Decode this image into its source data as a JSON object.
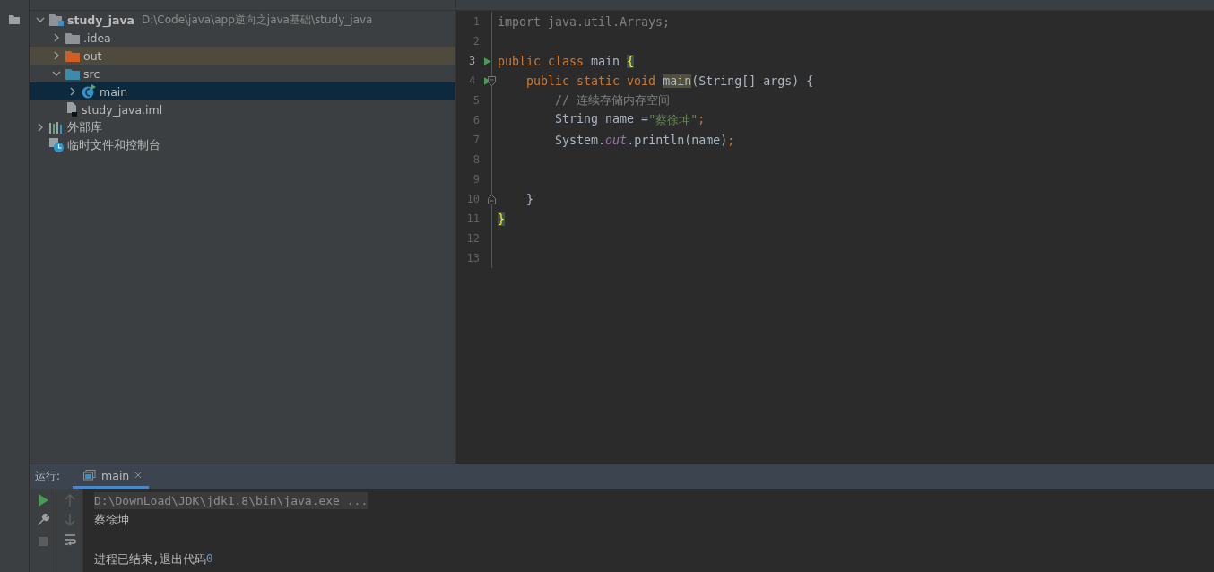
{
  "project_tree": {
    "items": [
      {
        "label": "study_java",
        "path": "D:\\Code\\java\\app逆向之java基础\\study_java",
        "kind": "module",
        "expanded": true,
        "selected": false,
        "children": [
          {
            "label": ".idea",
            "kind": "folder",
            "expanded": false,
            "selected": false
          },
          {
            "label": "out",
            "kind": "excluded-folder",
            "expanded": false,
            "selected": false
          },
          {
            "label": "src",
            "kind": "source-folder",
            "expanded": true,
            "selected": false,
            "children": [
              {
                "label": "main",
                "kind": "class",
                "expanded": false,
                "selected": true
              }
            ]
          },
          {
            "label": "study_java.iml",
            "kind": "file",
            "selected": false
          }
        ]
      },
      {
        "label": "外部库",
        "kind": "library",
        "expanded": false,
        "selected": false
      },
      {
        "label": "临时文件和控制台",
        "kind": "scratch",
        "selected": false
      }
    ]
  },
  "editor": {
    "lines": [
      {
        "number": "1",
        "current": false,
        "tokens": [
          {
            "kind": "unused",
            "text": "import java.util.Arrays;"
          }
        ]
      },
      {
        "number": "2",
        "current": false
      },
      {
        "number": "3",
        "current": true,
        "run": true,
        "tokens": [
          {
            "kind": "keyword",
            "text": "public class "
          },
          {
            "kind": "plain",
            "text": "main "
          },
          {
            "kind": "brace-match",
            "text": "{"
          }
        ]
      },
      {
        "number": "4",
        "current": false,
        "run": true,
        "fold_start": true,
        "tokens": [
          {
            "kind": "keyword",
            "text": "    public static void "
          },
          {
            "kind": "usage",
            "text": "main"
          },
          {
            "kind": "plain",
            "text": "(String[] args) {"
          }
        ]
      },
      {
        "number": "5",
        "current": false,
        "tokens": [
          {
            "kind": "comment",
            "text": "        // 连续存储内存空间"
          }
        ]
      },
      {
        "number": "6",
        "current": false,
        "tokens": [
          {
            "kind": "plain",
            "text": "        String name ="
          },
          {
            "kind": "string",
            "text": "\"蔡徐坤\""
          },
          {
            "kind": "keyword",
            "text": ";"
          }
        ]
      },
      {
        "number": "7",
        "current": false,
        "tokens": [
          {
            "kind": "plain",
            "text": "        System."
          },
          {
            "kind": "field",
            "text": "out"
          },
          {
            "kind": "plain",
            "text": ".println(name)"
          },
          {
            "kind": "keyword",
            "text": ";"
          }
        ]
      },
      {
        "number": "8",
        "current": false
      },
      {
        "number": "9",
        "current": false
      },
      {
        "number": "10",
        "current": false,
        "fold_end": true,
        "tokens": [
          {
            "kind": "plain",
            "text": "    }"
          }
        ]
      },
      {
        "number": "11",
        "current": false,
        "tokens": [
          {
            "kind": "brace-match",
            "text": "}"
          }
        ]
      },
      {
        "number": "12",
        "current": false
      },
      {
        "number": "13",
        "current": false
      }
    ]
  },
  "run_panel": {
    "label": "运行:",
    "tabs": [
      {
        "label": "main",
        "selected": true
      }
    ],
    "output": [
      {
        "kind": "command",
        "segments": [
          {
            "kind": "plain",
            "text": "D:\\DownLoad\\JDK\\jdk1.8\\bin\\java.exe ..."
          }
        ]
      },
      {
        "kind": "stdout",
        "segments": [
          {
            "kind": "plain",
            "text": "蔡徐坤"
          }
        ]
      },
      {
        "kind": "blank"
      },
      {
        "kind": "stdout",
        "segments": [
          {
            "kind": "plain",
            "text": "进程已结束,退出代码"
          },
          {
            "kind": "number",
            "text": "0"
          }
        ]
      }
    ]
  }
}
